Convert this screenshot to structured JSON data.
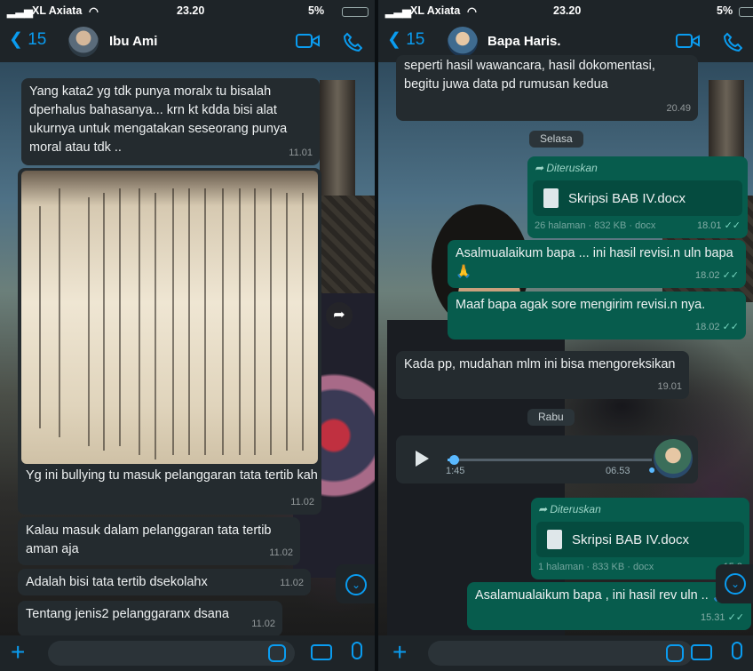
{
  "left": {
    "status": {
      "carrier": "XL Axiata",
      "time": "23.20",
      "battery": "5%"
    },
    "header": {
      "back_count": "15",
      "contact_name": "Ibu Ami"
    },
    "messages": [
      {
        "text": "Yang kata2 yg tdk punya moralx tu bisalah dperhalus bahasanya... krn kt kdda bisi alat ukurnya untuk mengatakan seseorang punya moral atau tdk ..",
        "time": "11.01"
      },
      {
        "text": "Yg ini bullying tu masuk pelanggaran tata tertib kah",
        "time": "11.02"
      },
      {
        "text": "Kalau masuk dalam pelanggaran tata tertib aman aja",
        "time": "11.02"
      },
      {
        "text": "Adalah bisi tata tertib dsekolahx",
        "time": "11.02"
      },
      {
        "text": "Tentang jenis2 pelanggaranx dsana",
        "time": "11.02"
      }
    ]
  },
  "right": {
    "status": {
      "carrier": "XL Axiata",
      "time": "23.20",
      "battery": "5%"
    },
    "header": {
      "back_count": "15",
      "contact_name": "Bapa Haris."
    },
    "top_message": {
      "text": "seperti hasil wawancara, hasil dokomentasi, begitu juwa data pd rumusan kedua",
      "time": "20.49"
    },
    "day1": "Selasa",
    "fwd1": {
      "label": "Diteruskan",
      "file": "Skripsi BAB IV.docx",
      "meta": "26 halaman · 832 KB · docx",
      "time": "18.01"
    },
    "out1": {
      "text": "Asalmualaikum bapa ... ini hasil revisi.n uln bapa 🙏",
      "time": "18.02"
    },
    "out2": {
      "text": "Maaf bapa agak sore mengirim revisi.n nya.",
      "time": "18.02"
    },
    "in1": {
      "text": "Kada pp, mudahan mlm ini bisa mengoreksikan",
      "time": "19.01"
    },
    "day2": "Rabu",
    "voice": {
      "elapsed": "1:45",
      "duration": "06.53",
      "progress": 0.03
    },
    "fwd2": {
      "label": "Diteruskan",
      "file": "Skripsi BAB IV.docx",
      "meta": "1 halaman · 833 KB · docx",
      "time": "15.3"
    },
    "out3": {
      "text": "Asalamualaikum bapa , ini hasil rev uln .. 🙏",
      "time": "15.31"
    }
  },
  "colors": {
    "accent": "#0a9cf0",
    "outgoing": "#075c4d",
    "incoming": "#242b2f"
  }
}
